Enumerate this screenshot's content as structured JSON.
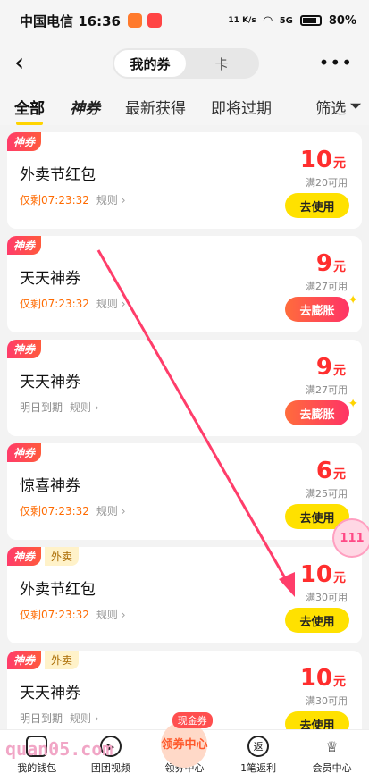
{
  "status_bar": {
    "carrier_time": "中国电信 16:36",
    "network": "5G",
    "speed": "11 K/s",
    "battery": "80%"
  },
  "header": {
    "back_icon": "chevron-left-icon",
    "segments": [
      "我的券",
      "卡"
    ],
    "more_icon": "more-dots-icon"
  },
  "filter_tabs": [
    "全部",
    "神券",
    "最新获得",
    "即将过期"
  ],
  "filter_label": "筛选",
  "coupons": [
    {
      "badges": [
        "神券"
      ],
      "title": "外卖节红包",
      "sub": "仅剩07:23:32",
      "rule": "规则 ›",
      "amount": "10",
      "unit": "元",
      "condition": "满20可用",
      "button": "去使用"
    },
    {
      "badges": [
        "神券"
      ],
      "title": "天天神券",
      "sub": "仅剩07:23:32",
      "rule": "规则 ›",
      "amount": "9",
      "unit": "元",
      "condition": "满27可用",
      "button": "去膨胀"
    },
    {
      "badges": [
        "神券"
      ],
      "title": "天天神券",
      "sub": "明日到期",
      "rule": "规则 ›",
      "amount": "9",
      "unit": "元",
      "condition": "满27可用",
      "button": "去膨胀"
    },
    {
      "badges": [
        "神券"
      ],
      "title": "惊喜神券",
      "sub": "仅剩07:23:32",
      "rule": "规则 ›",
      "amount": "6",
      "unit": "元",
      "condition": "满25可用",
      "button": "去使用"
    },
    {
      "badges": [
        "神券",
        "外卖"
      ],
      "title": "外卖节红包",
      "sub": "仅剩07:23:32",
      "rule": "规则 ›",
      "amount": "10",
      "unit": "元",
      "condition": "满30可用",
      "button": "去使用"
    },
    {
      "badges": [
        "神券",
        "外卖"
      ],
      "title": "天天神券",
      "sub": "明日到期",
      "rule": "规则 ›",
      "amount": "10",
      "unit": "元",
      "condition": "满30可用",
      "button": "去使用"
    }
  ],
  "floating_bubble": "111",
  "watermark": "quan05.com",
  "bottom_nav": {
    "wallet": "我的钱包",
    "video": "团团视频",
    "center_icon": "领券中心",
    "center": "领券中心",
    "cash_badge": "现金券",
    "rebate_icon": "返",
    "rebate": "1笔返利",
    "member": "会员中心"
  },
  "colors": {
    "accent_yellow": "#ffe100",
    "price_red": "#ff2e2e",
    "timer_orange": "#ff6a00",
    "annotation_arrow": "#ff3d6a"
  }
}
